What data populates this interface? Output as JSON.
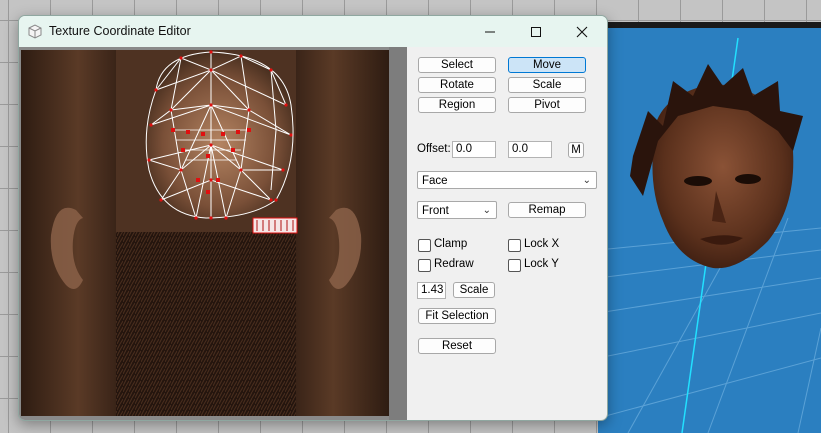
{
  "window": {
    "title": "Texture Coordinate Editor"
  },
  "tools": {
    "select": "Select",
    "move": "Move",
    "rotate": "Rotate",
    "scale": "Scale",
    "region": "Region",
    "pivot": "Pivot",
    "active": "Move"
  },
  "offset": {
    "label": "Offset:",
    "x": "0.0",
    "y": "0.0",
    "m_button": "M"
  },
  "group_select": {
    "value": "Face"
  },
  "projection": {
    "value": "Front",
    "remap_label": "Remap"
  },
  "options": {
    "clamp": {
      "label": "Clamp",
      "checked": false
    },
    "lock_x": {
      "label": "Lock X",
      "checked": false
    },
    "redraw": {
      "label": "Redraw",
      "checked": false
    },
    "lock_y": {
      "label": "Lock Y",
      "checked": false
    }
  },
  "scale_row": {
    "value": "1.43",
    "button": "Scale"
  },
  "buttons": {
    "fit_selection": "Fit Selection",
    "reset": "Reset"
  },
  "colors": {
    "title_bg": "#e7f5f0",
    "viewport_bg": "#2b7fc0",
    "active_btn": "#cce4f7",
    "uv_vertex": "#e01010"
  },
  "icons": [
    "app-icon",
    "minimize-icon",
    "maximize-icon",
    "close-icon",
    "chevron-down-icon"
  ]
}
